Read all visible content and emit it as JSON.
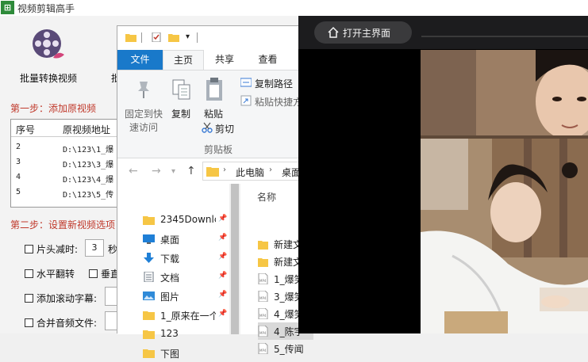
{
  "app": {
    "title": "视频剪辑高手",
    "logo_char": "⊞",
    "toolbar": [
      {
        "label": "批量转换视频"
      },
      {
        "label": "批"
      }
    ],
    "step1_title": "第一步：添加原视频",
    "table": {
      "headers": [
        "序号",
        "原视频地址"
      ],
      "rows": [
        {
          "idx": "2",
          "path": "D:\\123\\1_爆"
        },
        {
          "idx": "3",
          "path": "D:\\123\\3_爆"
        },
        {
          "idx": "4",
          "path": "D:\\123\\4_爆"
        },
        {
          "idx": "5",
          "path": "D:\\123\\5_传"
        }
      ]
    },
    "step2_title": "第二步：设置新视频选项",
    "options": {
      "trim_head_label": "片头减时:",
      "trim_head_value": "3",
      "trim_head_unit": "秒",
      "hflip_label": "水平翻转",
      "vflip_label": "垂直",
      "scroll_caption_label": "添加滚动字幕:",
      "merge_audio_label": "合并音频文件:"
    }
  },
  "explorer": {
    "tabs": {
      "file": "文件",
      "home": "主页",
      "share": "共享",
      "view": "查看"
    },
    "ribbon": {
      "pin_quick_access": "固定到快\n速访问",
      "pin_line1": "固定到快",
      "pin_line2": "速访问",
      "copy": "复制",
      "paste": "粘贴",
      "copy_path": "复制路径",
      "paste_shortcut": "粘贴快捷方",
      "cut": "剪切",
      "group_clipboard": "剪贴板"
    },
    "address": {
      "this_pc": "此电脑",
      "next": "桌面"
    },
    "nav_items": [
      {
        "label": "2345Downlc",
        "icon": "folder-icon"
      },
      {
        "label": "桌面",
        "icon": "desktop-icon"
      },
      {
        "label": "下载",
        "icon": "download-icon"
      },
      {
        "label": "文档",
        "icon": "document-icon"
      },
      {
        "label": "图片",
        "icon": "pictures-icon"
      },
      {
        "label": "1_原来在一个",
        "icon": "folder-icon"
      },
      {
        "label": "123",
        "icon": "folder-icon"
      },
      {
        "label": "下图",
        "icon": "folder-icon"
      }
    ],
    "column_name": "名称",
    "files": [
      {
        "label": "新建文",
        "icon": "folder-icon"
      },
      {
        "label": "新建文",
        "icon": "folder-icon"
      },
      {
        "label": "1_爆笑",
        "icon": "mp4-file-icon"
      },
      {
        "label": "3_爆笑",
        "icon": "mp4-file-icon"
      },
      {
        "label": "4_爆笑",
        "icon": "mp4-file-icon"
      },
      {
        "label": "4_陈宇",
        "icon": "mp4-file-icon"
      },
      {
        "label": "5_传闻",
        "icon": "mp4-file-icon"
      }
    ]
  },
  "player": {
    "open_main_label": "打开主界面"
  },
  "colors": {
    "ribbon_file_tab": "#1979ca",
    "step_title": "#c0392b",
    "player_bar": "#1c1c1e",
    "folder": "#f6c645"
  }
}
